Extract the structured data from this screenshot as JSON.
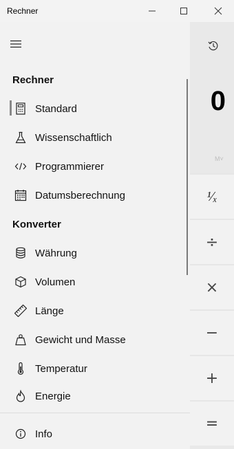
{
  "window": {
    "title": "Rechner",
    "controls": {
      "minimize": "—",
      "maximize": "☐",
      "close": "✕"
    }
  },
  "nav": {
    "menu_icon": "hamburger-icon",
    "sections": [
      {
        "header": "Rechner",
        "items": [
          {
            "label": "Standard",
            "icon": "calculator-icon",
            "selected": true
          },
          {
            "label": "Wissenschaftlich",
            "icon": "flask-icon"
          },
          {
            "label": "Programmierer",
            "icon": "code-icon"
          },
          {
            "label": "Datumsberechnung",
            "icon": "calendar-icon"
          }
        ]
      },
      {
        "header": "Konverter",
        "items": [
          {
            "label": "Währung",
            "icon": "coins-icon"
          },
          {
            "label": "Volumen",
            "icon": "cube-icon"
          },
          {
            "label": "Länge",
            "icon": "ruler-icon"
          },
          {
            "label": "Gewicht und Masse",
            "icon": "weight-icon"
          },
          {
            "label": "Temperatur",
            "icon": "thermometer-icon"
          },
          {
            "label": "Energie",
            "icon": "flame-icon"
          }
        ]
      }
    ],
    "footer": {
      "label": "Info",
      "icon": "info-icon"
    }
  },
  "calculator": {
    "history_icon": "history-icon",
    "display_value": "0",
    "memory_label": "M˅",
    "keys": [
      {
        "label": "¹⁄ₓ",
        "name": "reciprocal-key"
      },
      {
        "label": "÷",
        "name": "divide-key"
      },
      {
        "label": "×",
        "name": "multiply-key"
      },
      {
        "label": "−",
        "name": "subtract-key"
      },
      {
        "label": "+",
        "name": "add-key"
      },
      {
        "label": "=",
        "name": "equals-key"
      }
    ]
  }
}
